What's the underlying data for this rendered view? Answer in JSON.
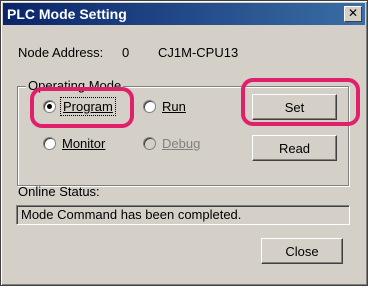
{
  "window": {
    "title": "PLC Mode Setting",
    "close_glyph": "✕"
  },
  "node": {
    "label": "Node Address:",
    "value": "0",
    "device": "CJ1M-CPU13"
  },
  "operating_mode": {
    "legend": "Operating Mode",
    "options": [
      {
        "label": "Program",
        "selected": true,
        "enabled": true
      },
      {
        "label": "Run",
        "selected": false,
        "enabled": true
      },
      {
        "label": "Monitor",
        "selected": false,
        "enabled": true
      },
      {
        "label": "Debug",
        "selected": false,
        "enabled": false
      }
    ]
  },
  "buttons": {
    "set": "Set",
    "read": "Read",
    "close": "Close"
  },
  "status": {
    "label": "Online Status:",
    "message": "Mode Command has been completed."
  },
  "annotation_color": "#e0206a"
}
